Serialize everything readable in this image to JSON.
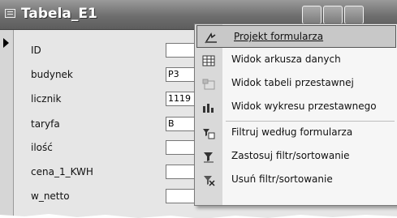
{
  "window": {
    "title": "Tabela_E1"
  },
  "form": {
    "fields": [
      {
        "label": "ID",
        "value": ""
      },
      {
        "label": "budynek",
        "value": "P3"
      },
      {
        "label": "licznik",
        "value": "1119"
      },
      {
        "label": "taryfa",
        "value": "B"
      },
      {
        "label": "ilość",
        "value": ""
      },
      {
        "label": "cena_1_KWH",
        "value": ""
      },
      {
        "label": "w_netto",
        "value": ""
      }
    ]
  },
  "context_menu": {
    "items": [
      {
        "label": "Projekt formularza",
        "icon": "design-view-icon",
        "highlighted": true
      },
      {
        "label": "Widok arkusza danych",
        "icon": "datasheet-view-icon"
      },
      {
        "label": "Widok tabeli przestawnej",
        "icon": "pivot-table-icon"
      },
      {
        "label": "Widok wykresu przestawnego",
        "icon": "pivot-chart-icon"
      },
      {
        "label": "Filtruj według formularza",
        "icon": "filter-by-form-icon"
      },
      {
        "label": "Zastosuj filtr/sortowanie",
        "icon": "apply-filter-icon"
      },
      {
        "label": "Usuń filtr/sortowanie",
        "icon": "remove-filter-icon"
      }
    ]
  }
}
